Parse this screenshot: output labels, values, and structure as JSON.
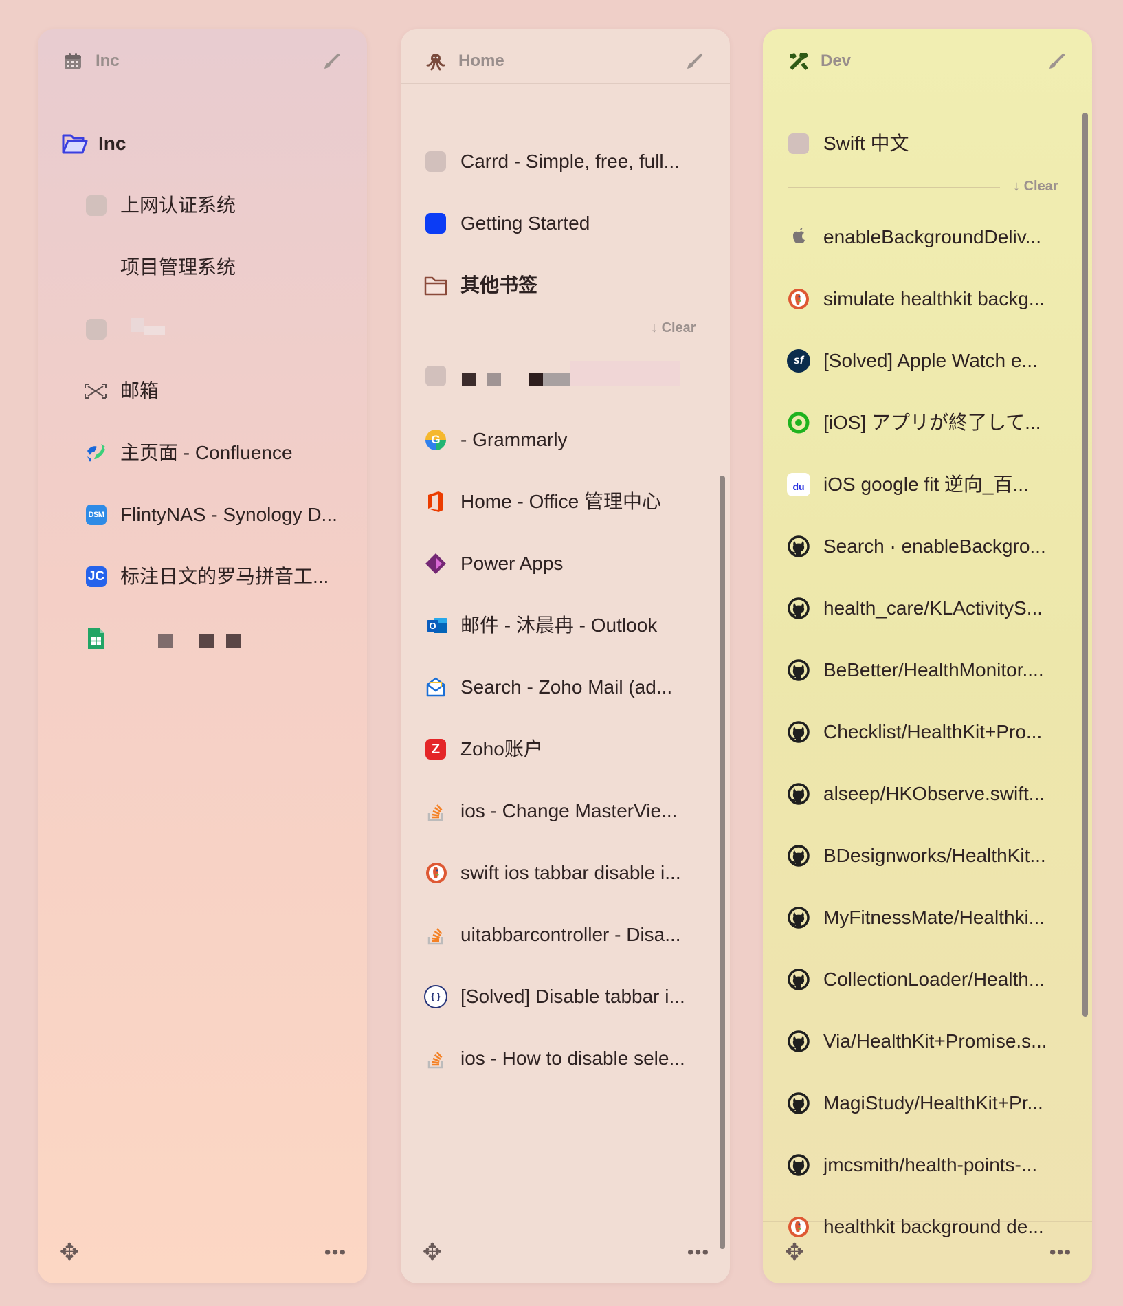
{
  "panels": {
    "inc": {
      "title": "Inc",
      "header_icon": "calendar-icon",
      "folder_title": "Inc",
      "items": [
        {
          "label": "上网认证系统",
          "icon": "blank-favicon-icon"
        },
        {
          "label": "项目管理系统",
          "icon": "none"
        },
        {
          "label": "",
          "icon": "blank-favicon-icon"
        },
        {
          "label": "邮箱",
          "icon": "mail-grid-icon"
        },
        {
          "label": "主页面 - Confluence",
          "icon": "confluence-icon"
        },
        {
          "label": "FlintyNAS - Synology D...",
          "icon": "dsm-icon",
          "icon_text": "DSM"
        },
        {
          "label": "标注日文的罗马拼音工...",
          "icon": "jc-icon",
          "icon_text": "JC"
        },
        {
          "label": "",
          "icon": "google-sheets-icon"
        }
      ]
    },
    "home": {
      "title": "Home",
      "header_icon": "octopus-icon",
      "pinned": [
        {
          "label": "Carrd - Simple, free, full...",
          "icon": "blank-favicon-icon"
        },
        {
          "label": "Getting Started",
          "icon": "blue-square-icon"
        },
        {
          "label": "其他书签",
          "icon": "folder-icon"
        }
      ],
      "clear_label": "Clear",
      "items": [
        {
          "label": "",
          "icon": "blank-favicon-icon"
        },
        {
          "label": "- Grammarly",
          "icon": "grammarly-icon",
          "icon_text": "G"
        },
        {
          "label": "Home - Office 管理中心",
          "icon": "office-icon"
        },
        {
          "label": "Power Apps",
          "icon": "power-apps-icon"
        },
        {
          "label": "邮件 - 沐晨冉 - Outlook",
          "icon": "outlook-icon",
          "icon_text": "O"
        },
        {
          "label": "Search - Zoho Mail (ad...",
          "icon": "zoho-mail-icon"
        },
        {
          "label": "Zoho账户",
          "icon": "zoho-icon",
          "icon_text": "Z"
        },
        {
          "label": "ios - Change MasterVie...",
          "icon": "stackoverflow-icon"
        },
        {
          "label": "swift ios tabbar disable i...",
          "icon": "duckduckgo-icon"
        },
        {
          "label": "uitabbarcontroller - Disa...",
          "icon": "stackoverflow-icon"
        },
        {
          "label": "[Solved] Disable tabbar i...",
          "icon": "braces-icon",
          "icon_text": "{ }"
        },
        {
          "label": "ios - How to disable sele...",
          "icon": "stackoverflow-icon"
        }
      ]
    },
    "dev": {
      "title": "Dev",
      "header_icon": "tools-icon",
      "pinned": [
        {
          "label": "Swift 中文",
          "icon": "blank-favicon-icon"
        }
      ],
      "clear_label": "Clear",
      "items": [
        {
          "label": "enableBackgroundDeliv...",
          "icon": "apple-icon"
        },
        {
          "label": "simulate healthkit backg...",
          "icon": "duckduckgo-icon"
        },
        {
          "label": "[Solved] Apple Watch e...",
          "icon": "sf-icon",
          "icon_text": "sf"
        },
        {
          "label": "[iOS] アプリが終了して...",
          "icon": "green-ring-icon"
        },
        {
          "label": "iOS google fit 逆向_百...",
          "icon": "baidu-icon",
          "icon_text": "du"
        },
        {
          "label": "Search · enableBackgro...",
          "icon": "github-icon"
        },
        {
          "label": "health_care/KLActivityS...",
          "icon": "github-icon"
        },
        {
          "label": "BeBetter/HealthMonitor....",
          "icon": "github-icon"
        },
        {
          "label": "Checklist/HealthKit+Pro...",
          "icon": "github-icon"
        },
        {
          "label": "alseep/HKObserve.swift...",
          "icon": "github-icon"
        },
        {
          "label": "BDesignworks/HealthKit...",
          "icon": "github-icon"
        },
        {
          "label": "MyFitnessMate/Healthki...",
          "icon": "github-icon"
        },
        {
          "label": "CollectionLoader/Health...",
          "icon": "github-icon"
        },
        {
          "label": "Via/HealthKit+Promise.s...",
          "icon": "github-icon"
        },
        {
          "label": "MagiStudy/HealthKit+Pr...",
          "icon": "github-icon"
        },
        {
          "label": "jmcsmith/health-points-...",
          "icon": "github-icon"
        },
        {
          "label": "healthkit background de...",
          "icon": "duckduckgo-icon"
        }
      ]
    }
  },
  "footer": {
    "move_icon": "move-icon",
    "more_icon": "more-icon"
  },
  "colors": {
    "inc_folder": "#3a3fe0",
    "home_folder": "#8a4a3a"
  }
}
